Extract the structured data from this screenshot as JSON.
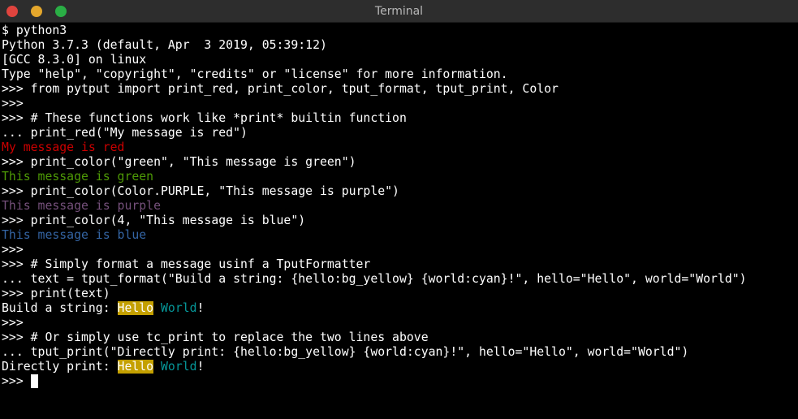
{
  "window": {
    "title": "Terminal",
    "buttons": [
      {
        "name": "close-button",
        "color": "#e0443e"
      },
      {
        "name": "minimize-button",
        "color": "#e4a72c"
      },
      {
        "name": "maximize-button",
        "color": "#2aae45"
      }
    ]
  },
  "colors": {
    "background": "#000000",
    "foreground": "#ffffff",
    "red": "#cc0000",
    "green": "#4e9a06",
    "purple": "#75507b",
    "blue": "#3465a4",
    "cyan": "#06989a",
    "bg_yellow": "#c4a000"
  },
  "terminal": {
    "lines": [
      [
        {
          "t": "$ python3"
        }
      ],
      [
        {
          "t": "Python 3.7.3 (default, Apr  3 2019, 05:39:12)"
        }
      ],
      [
        {
          "t": "[GCC 8.3.0] on linux"
        }
      ],
      [
        {
          "t": "Type \"help\", \"copyright\", \"credits\" or \"license\" for more information."
        }
      ],
      [
        {
          "t": ">>> from pytput import print_red, print_color, tput_format, tput_print, Color"
        }
      ],
      [
        {
          "t": ">>>"
        }
      ],
      [
        {
          "t": ">>> # These functions work like *print* builtin function"
        }
      ],
      [
        {
          "t": "... print_red(\"My message is red\")"
        }
      ],
      [
        {
          "t": "My message is red",
          "fg": "red"
        }
      ],
      [
        {
          "t": ">>> print_color(\"green\", \"This message is green\")"
        }
      ],
      [
        {
          "t": "This message is green",
          "fg": "green"
        }
      ],
      [
        {
          "t": ">>> print_color(Color.PURPLE, \"This message is purple\")"
        }
      ],
      [
        {
          "t": "This message is purple",
          "fg": "purple"
        }
      ],
      [
        {
          "t": ">>> print_color(4, \"This message is blue\")"
        }
      ],
      [
        {
          "t": "This message is blue",
          "fg": "blue"
        }
      ],
      [
        {
          "t": ">>>"
        }
      ],
      [
        {
          "t": ">>> # Simply format a message usinf a TputFormatter"
        }
      ],
      [
        {
          "t": "... text = tput_format(\"Build a string: {hello:bg_yellow} {world:cyan}!\", hello=\"Hello\", world=\"World\")"
        }
      ],
      [
        {
          "t": ">>> print(text)"
        }
      ],
      [
        {
          "t": "Build a string: "
        },
        {
          "t": "Hello",
          "bg": "bg_yellow"
        },
        {
          "t": " "
        },
        {
          "t": "World",
          "fg": "cyan"
        },
        {
          "t": "!"
        }
      ],
      [
        {
          "t": ">>>"
        }
      ],
      [
        {
          "t": ">>> # Or simply use tc_print to replace the two lines above"
        }
      ],
      [
        {
          "t": "... tput_print(\"Directly print: {hello:bg_yellow} {world:cyan}!\", hello=\"Hello\", world=\"World\")"
        }
      ],
      [
        {
          "t": "Directly print: "
        },
        {
          "t": "Hello",
          "bg": "bg_yellow"
        },
        {
          "t": " "
        },
        {
          "t": "World",
          "fg": "cyan"
        },
        {
          "t": "!"
        }
      ],
      [
        {
          "t": ">>> "
        },
        {
          "cursor": true
        }
      ]
    ]
  }
}
